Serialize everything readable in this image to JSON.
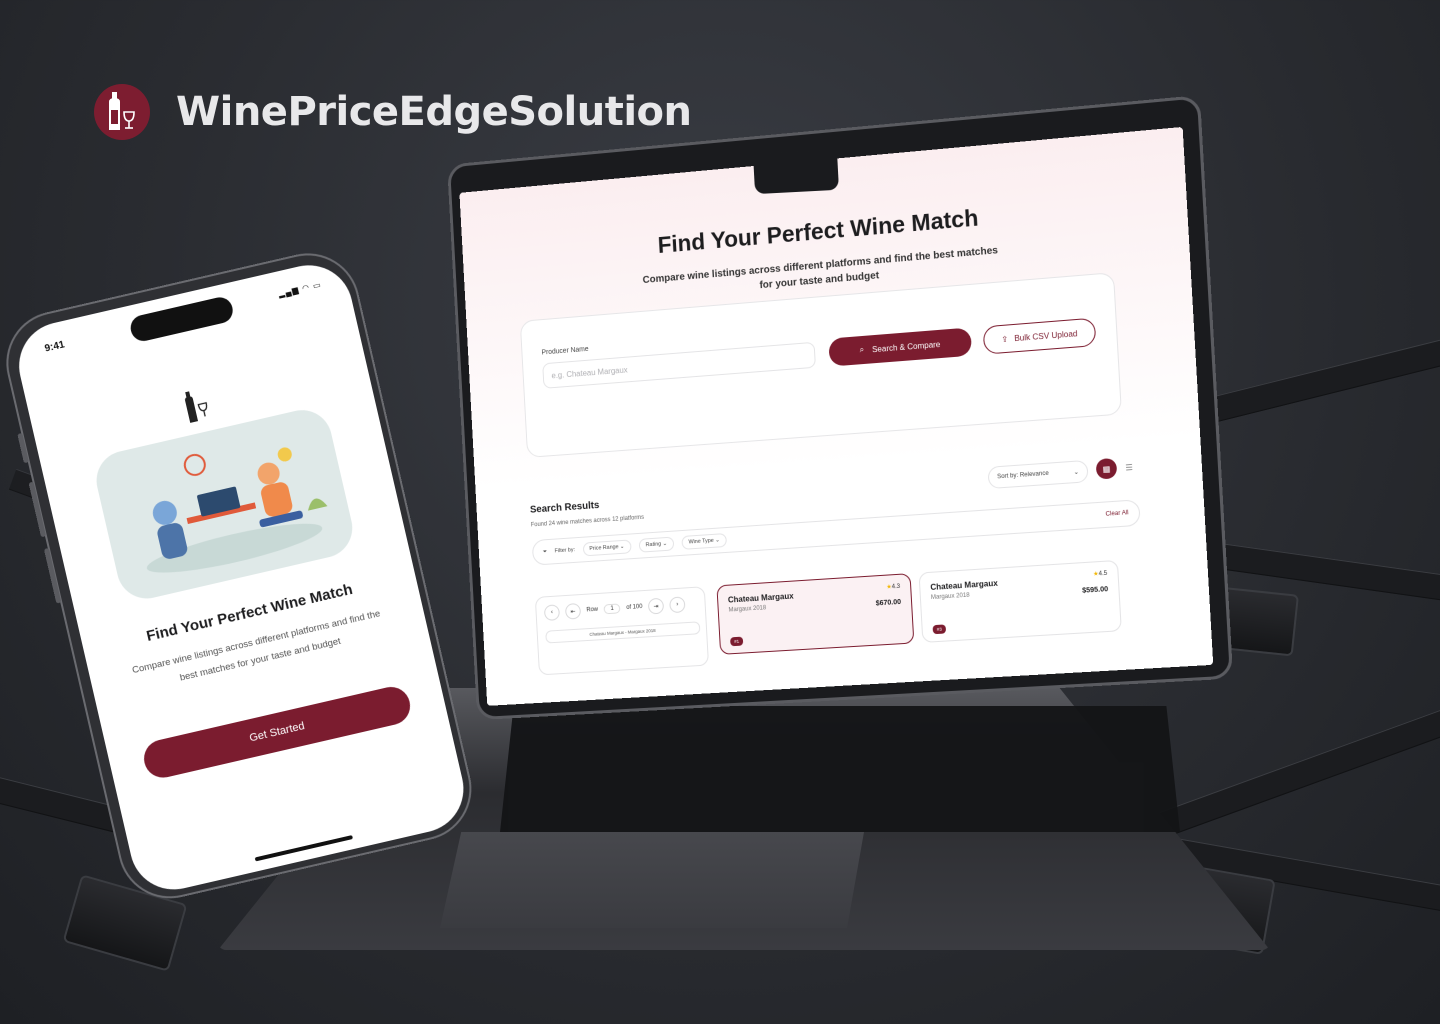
{
  "brand": {
    "title": "WinePriceEdgeSolution",
    "logo_icon": "wine-bottle-glass-icon",
    "color": "#7d1d30"
  },
  "web": {
    "hero": {
      "title": "Find Your Perfect Wine Match",
      "subtitle": "Compare wine listings across different platforms and find the best matches for your taste and budget"
    },
    "search": {
      "label": "Producer Name",
      "placeholder": "e.g. Chateau Margaux",
      "search_button": "Search & Compare",
      "csv_button": "Bulk CSV Upload"
    },
    "results": {
      "title": "Search Results",
      "subtitle": "Found 24 wine matches across 12 platforms",
      "sort_label": "Sort by: Relevance",
      "filter_label": "Filter by:",
      "filters": [
        "Price Range",
        "Rating",
        "Wine Type"
      ],
      "clear_all": "Clear All"
    },
    "pager": {
      "row_label": "Row",
      "row_value": "1",
      "total": "of 100",
      "caption": "Chateau Margaux - Margaux 2018"
    },
    "cards": [
      {
        "name": "Chateau Margaux",
        "sub": "Margaux 2018",
        "rating": "4.3",
        "price": "$670.00",
        "badge": "#1",
        "selected": true
      },
      {
        "name": "Chateau Margaux",
        "sub": "Margaux 2018",
        "rating": "4.5",
        "price": "$595.00",
        "badge": "#3",
        "selected": false
      }
    ],
    "accent": "#7b1c2f"
  },
  "phone": {
    "time": "9:41",
    "title": "Find Your Perfect Wine Match",
    "subtitle": "Compare wine listings across different platforms and find the best matches for your taste and budget",
    "cta": "Get Started"
  }
}
